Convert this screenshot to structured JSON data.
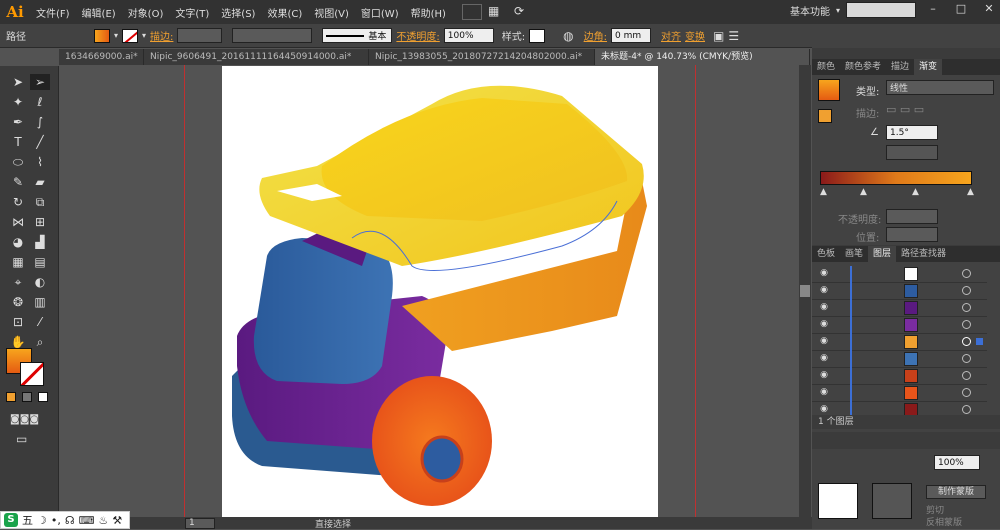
{
  "app": {
    "logo": "Ai"
  },
  "menu": [
    "文件(F)",
    "编辑(E)",
    "对象(O)",
    "文字(T)",
    "选择(S)",
    "效果(C)",
    "视图(V)",
    "窗口(W)",
    "帮助(H)"
  ],
  "workspace": "基本功能",
  "options": {
    "mode": "路径",
    "stroke_label": "描边:",
    "stroke_style": "基本",
    "opacity_label": "不透明度:",
    "opacity_value": "100%",
    "style_label": "样式:",
    "corner_label": "边角:",
    "corner_value": "0 mm",
    "align_label": "对齐",
    "transform_label": "变换"
  },
  "tabs": [
    "1634669000.ai*",
    "Nipic_9606491_20161111164450914000.ai*",
    "Nipic_13983055_20180727214204802000.ai*",
    "未标题-4* @ 140.73% (CMYK/预览)"
  ],
  "gradient_panel": {
    "tabs": [
      "颜色",
      "颜色参考",
      "描边",
      "渐变"
    ],
    "type_label": "类型:",
    "type_value": "线性",
    "stroke_label": "描边:",
    "angle_value": "1.5°",
    "opacity_label": "不透明度:",
    "position_label": "位置:"
  },
  "layers_panel": {
    "tabs": [
      "色板",
      "画笔",
      "图层",
      "路径查找器"
    ],
    "footer": "1 个图层"
  },
  "bottom_panel": {
    "opacity_value": "100%",
    "mask_button": "制作蒙版",
    "clip_label": "剪切",
    "invert_label": "反相蒙版"
  },
  "status": {
    "page": "1",
    "tool": "直接选择"
  },
  "ime": {
    "logo": "S",
    "char": "五"
  },
  "colors": {
    "accent_orange": "#f0a030",
    "layer_blue": "#3c6fd6",
    "fill_gradient_start": "#f7a51d",
    "fill_gradient_end": "#e55b12"
  }
}
